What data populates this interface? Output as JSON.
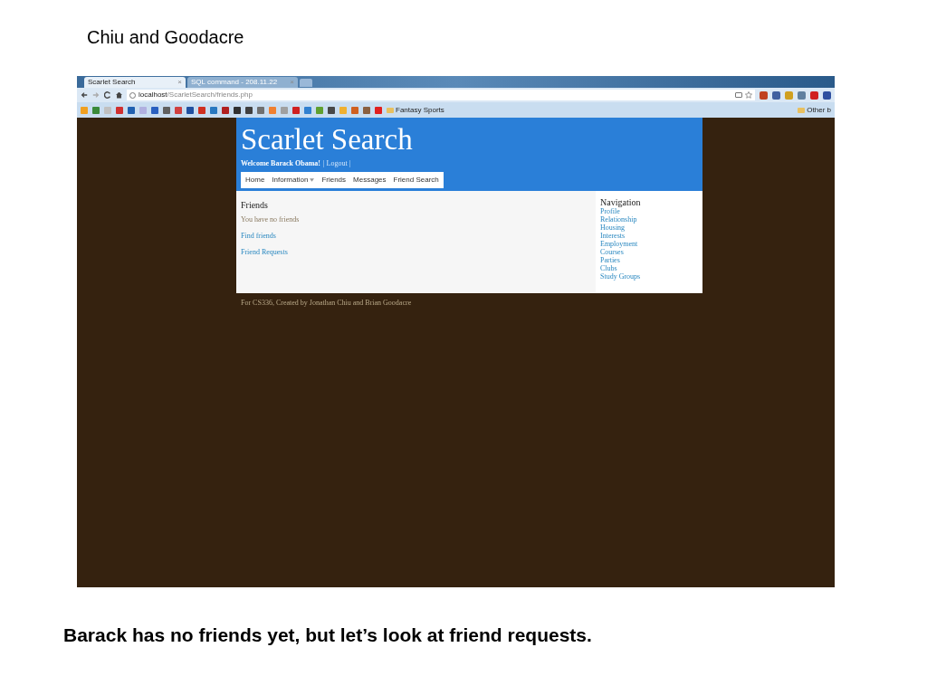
{
  "slide_title": "Chiu and Goodacre",
  "browser": {
    "tabs": [
      {
        "label": "Scarlet Search",
        "close": "×",
        "selected": true
      },
      {
        "label": "SQL command - 208.11.22",
        "close": "×",
        "selected": false
      }
    ],
    "address": {
      "host": "localhost",
      "path": "/ScarletSearch/friends.php"
    },
    "bookmark_folder": "Fantasy Sports",
    "other_bookmarks": "Other b"
  },
  "site": {
    "title": "Scarlet Search",
    "welcome": "Welcome Barack Obama!",
    "logout": "| Logout |",
    "nav": [
      {
        "label": "Home",
        "dropdown": false
      },
      {
        "label": "Information",
        "dropdown": true
      },
      {
        "label": "Friends",
        "dropdown": false
      },
      {
        "label": "Messages",
        "dropdown": false
      },
      {
        "label": "Friend Search",
        "dropdown": false
      }
    ],
    "heading": "Friends",
    "message": "You have no friends",
    "links": [
      "Find friends",
      "Friend Requests"
    ],
    "sidebar": {
      "heading": "Navigation",
      "items": [
        "Profile",
        "Relationship",
        "Housing",
        "Interests",
        "Employment",
        "Courses",
        "Parties",
        "Clubs",
        "Study Groups"
      ]
    },
    "footer": "For CS336, Created by Jonathan Chiu and Brian Goodacre"
  },
  "caption": "Barack has no friends yet, but let’s look at friend requests."
}
